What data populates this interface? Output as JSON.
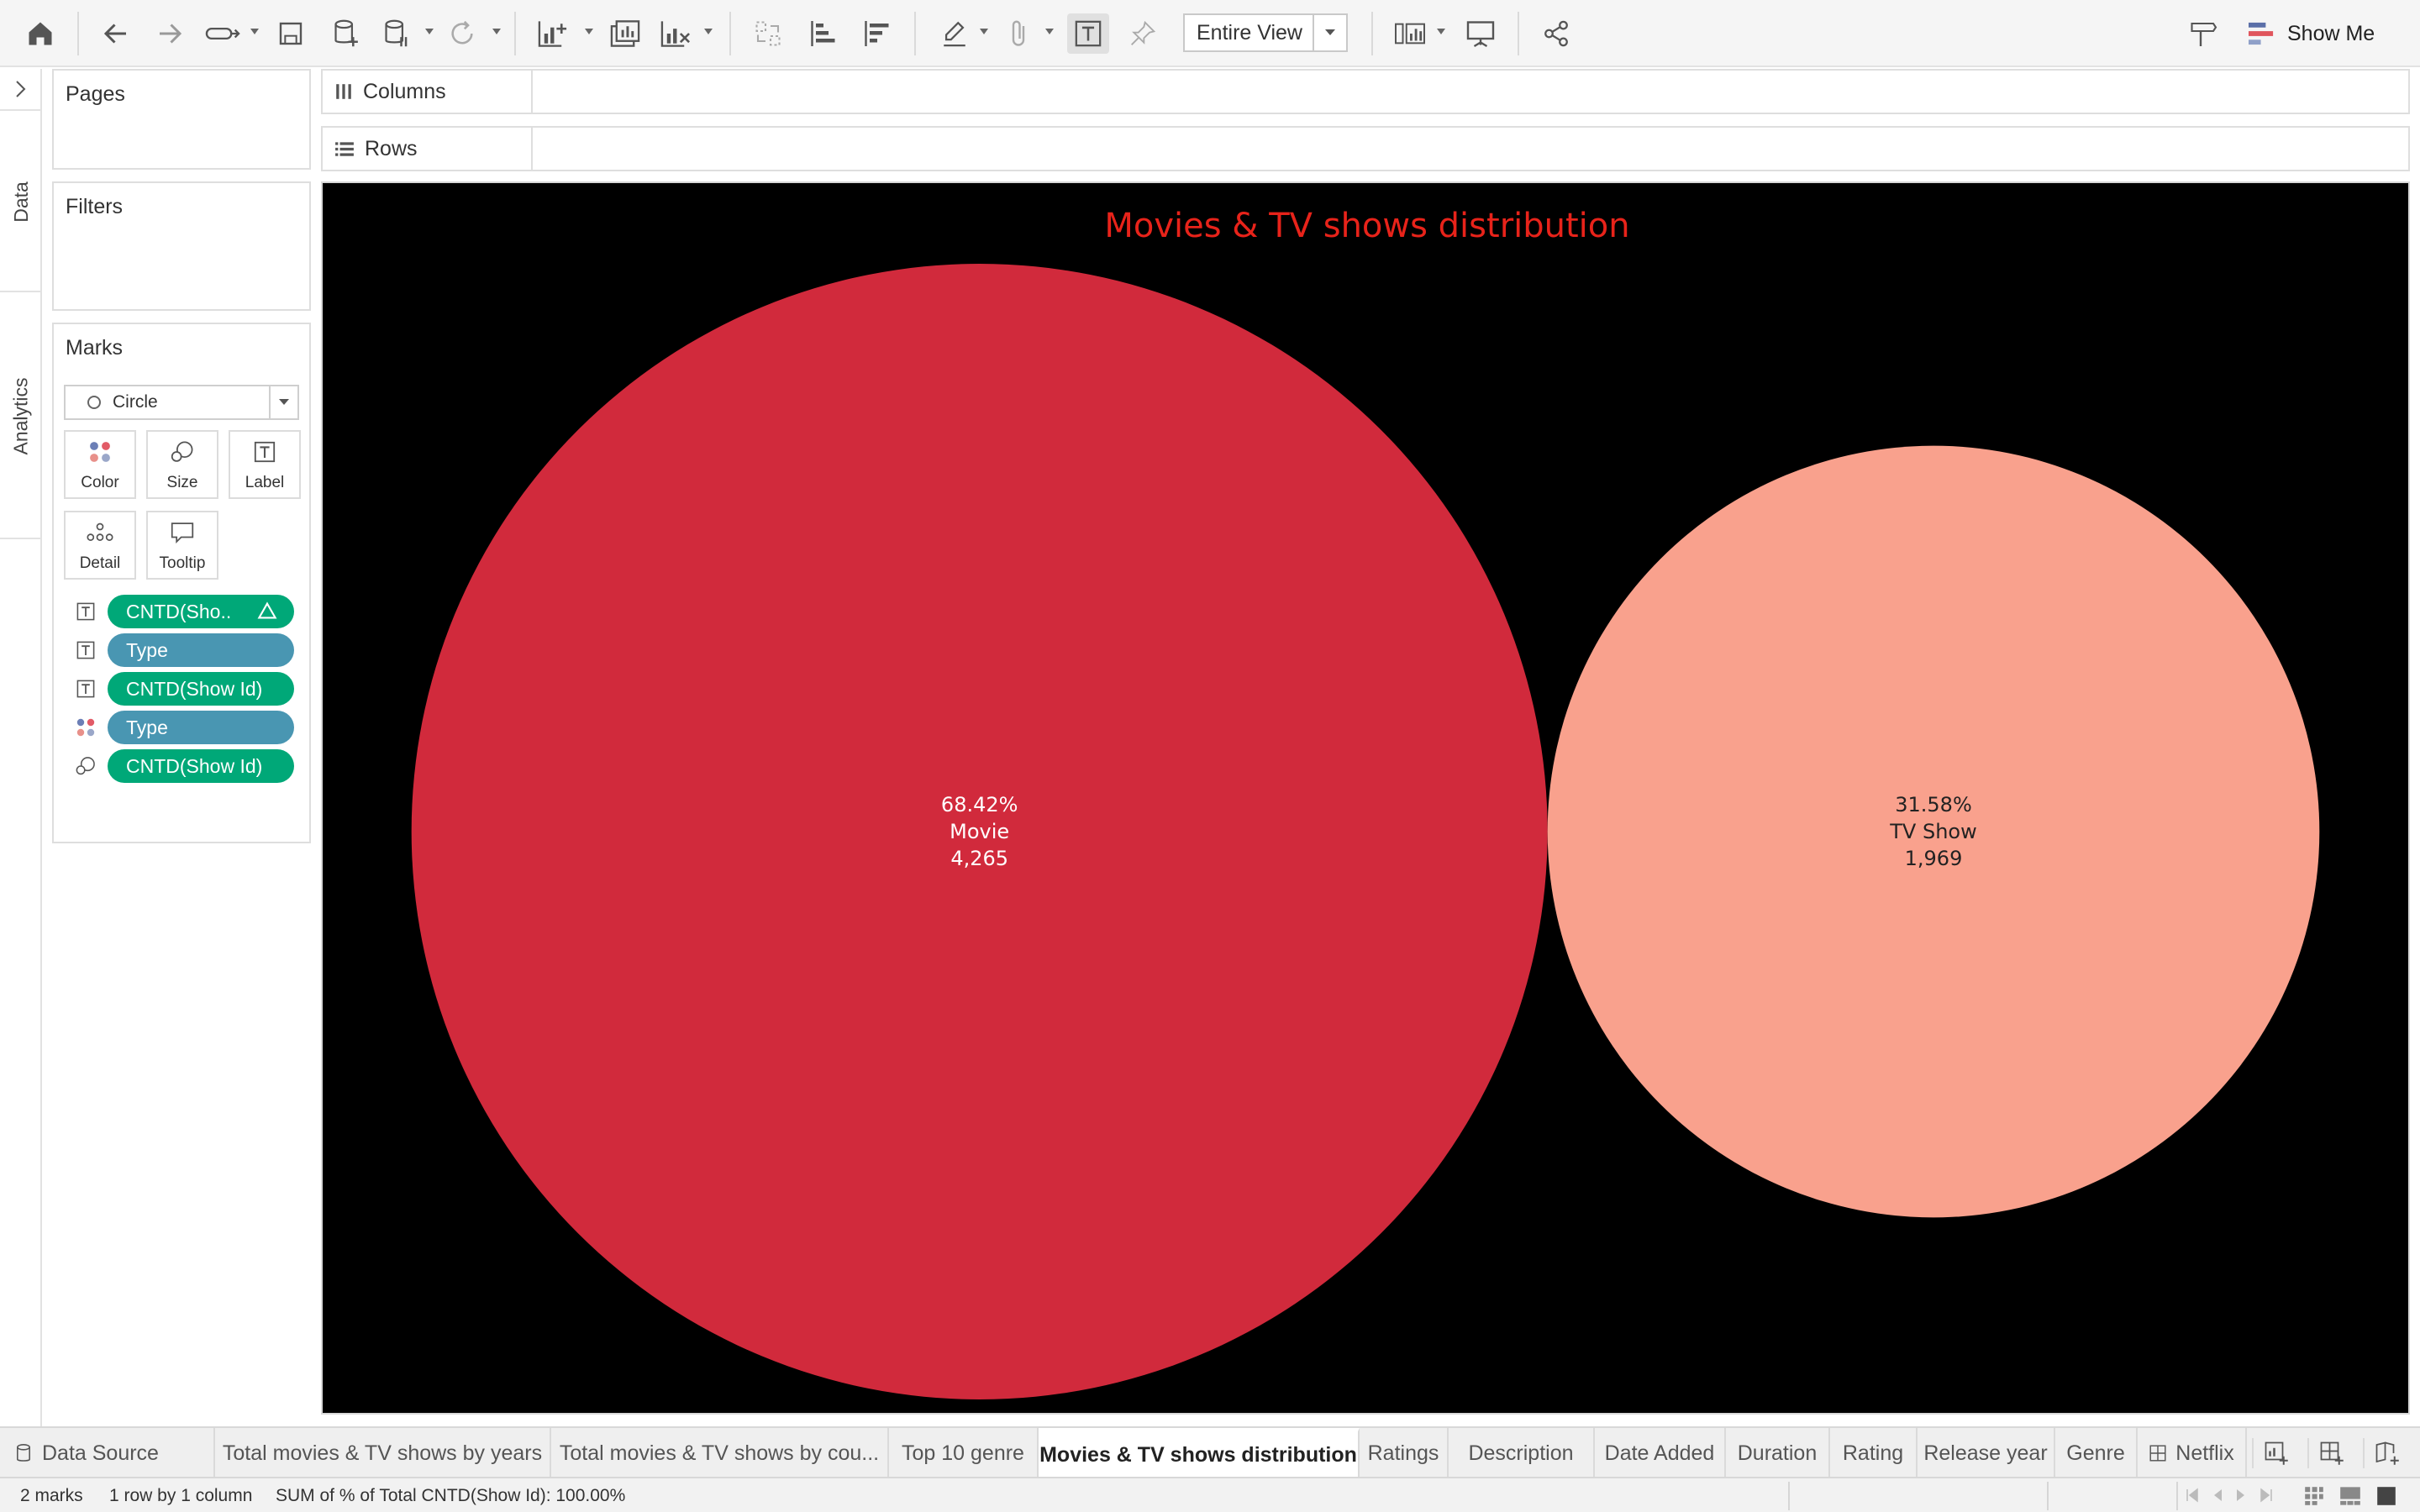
{
  "toolbar": {
    "view_select": "Entire View",
    "show_me": "Show Me"
  },
  "rail": {
    "tabs": [
      "Data",
      "Analytics"
    ]
  },
  "cards": {
    "pages": "Pages",
    "filters": "Filters",
    "marks": "Marks"
  },
  "marks": {
    "type": "Circle",
    "buttons": [
      "Color",
      "Size",
      "Label",
      "Detail",
      "Tooltip"
    ],
    "pills": [
      {
        "label": "CNTD(Sho..",
        "kind": "measure",
        "icon": "label-icon"
      },
      {
        "label": "Type",
        "kind": "dimension",
        "icon": "label-icon"
      },
      {
        "label": "CNTD(Show Id)",
        "kind": "measure",
        "icon": "label-icon"
      },
      {
        "label": "Type",
        "kind": "dimension",
        "icon": "color-icon"
      },
      {
        "label": "CNTD(Show Id)",
        "kind": "measure",
        "icon": "size-icon"
      }
    ]
  },
  "shelves": {
    "columns": "Columns",
    "rows": "Rows"
  },
  "chart_data": {
    "type": "bubble",
    "title": "Movies & TV shows distribution",
    "categories": [
      "Movie",
      "TV Show"
    ],
    "values": [
      4265,
      1969
    ],
    "percent_labels": [
      "68.42%",
      "31.58%"
    ],
    "value_labels": [
      "4,265",
      "1,969"
    ],
    "colors": [
      "#d12a3c",
      "#f9a18d"
    ],
    "label_colors": [
      "#ffffff",
      "#222222"
    ],
    "title_color": "#e8231a",
    "background": "#000000"
  },
  "tabs": [
    "Data Source",
    "Total movies & TV shows by years",
    "Total movies & TV shows by cou...",
    "Top 10 genre",
    "Movies & TV shows distribution",
    "Ratings",
    "Description",
    "Date Added",
    "Duration",
    "Rating",
    "Release year",
    "Genre",
    "Netflix"
  ],
  "status": {
    "marks": "2 marks",
    "layout": "1 row by 1 column",
    "sum": "SUM of % of Total CNTD(Show Id): 100.00%"
  }
}
